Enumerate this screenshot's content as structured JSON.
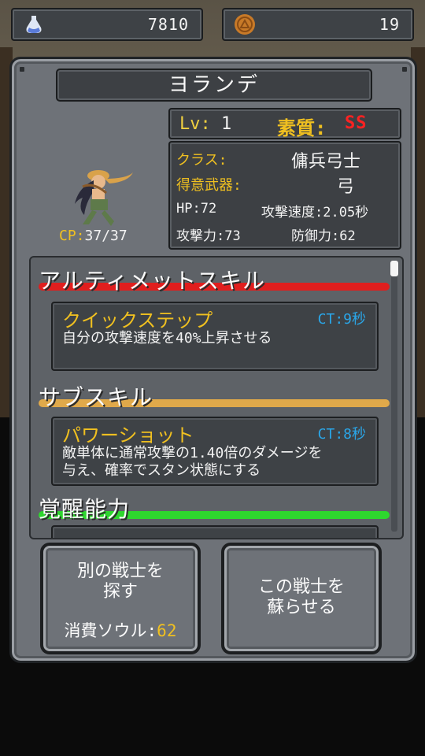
{
  "currencies": {
    "soul": {
      "icon": "soul-flask-icon",
      "value": "7810"
    },
    "coin": {
      "icon": "gold-coin-icon",
      "value": "19"
    }
  },
  "character": {
    "name": "ヨランデ",
    "level_label": "Lv:",
    "level": "1",
    "quality_label": "素質:",
    "rank": "SS",
    "class_label": "クラス:",
    "class_value": "傭兵弓士",
    "weapon_label": "得意武器:",
    "weapon_value": "弓",
    "hp": "HP:72",
    "attack_speed": "攻撃速度:2.05秒",
    "attack": "攻撃力:73",
    "defense": "防御力:62",
    "cp_label": "CP:",
    "cp_value": "37/37"
  },
  "sections": {
    "ultimate": {
      "title": "アルティメットスキル",
      "color": "#e01e1e",
      "skill_name": "クイックステップ",
      "ct": "CT:9秒",
      "desc": "自分の攻撃速度を40%上昇させる"
    },
    "sub": {
      "title": "サブスキル",
      "color": "#e0a94a",
      "skill_name": "パワーショット",
      "ct": "CT:8秒",
      "desc_line1": "敵単体に通常攻撃の1.40倍のダメージを",
      "desc_line2": "与え、確率でスタン状態にする"
    },
    "awaken": {
      "title": "覚醒能力",
      "color": "#2ed62e"
    }
  },
  "buttons": {
    "search": {
      "line1": "別の戦士を",
      "line2": "探す",
      "cost_label": "消費ソウル:",
      "cost_value": "62"
    },
    "revive": {
      "line1": "この戦士を",
      "line2": "蘇らせる"
    }
  }
}
